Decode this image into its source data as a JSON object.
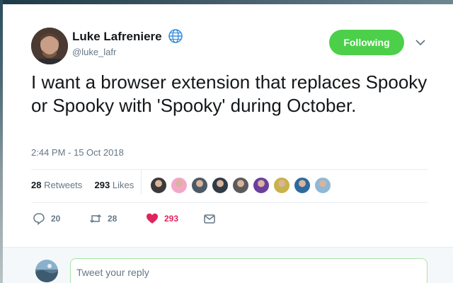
{
  "author": {
    "name": "Luke Lafreniere",
    "handle": "@luke_lafr"
  },
  "follow_button_label": "Following",
  "tweet": {
    "text": "I want a browser extension that replaces Spooky or Spooky with 'Spooky' during October.",
    "timestamp": "2:44 PM - 15 Oct 2018"
  },
  "stats": {
    "retweets_count": "28",
    "retweets_label": "Retweets",
    "likes_count": "293",
    "likes_label": "Likes"
  },
  "likers": [
    {
      "color": "#3a3a3a"
    },
    {
      "color": "#f3a7c8"
    },
    {
      "color": "#4a5a66"
    },
    {
      "color": "#2f3b45"
    },
    {
      "color": "#5b5b5b"
    },
    {
      "color": "#6b3fa0"
    },
    {
      "color": "#c8b24a"
    },
    {
      "color": "#2e6a9e"
    },
    {
      "color": "#8fb8d6"
    }
  ],
  "actions": {
    "reply_count": "20",
    "retweet_count": "28",
    "like_count": "293"
  },
  "reply": {
    "placeholder": "Tweet your reply"
  },
  "colors": {
    "follow_green": "#4cd04a",
    "like_red": "#e0245e",
    "muted": "#657786"
  }
}
